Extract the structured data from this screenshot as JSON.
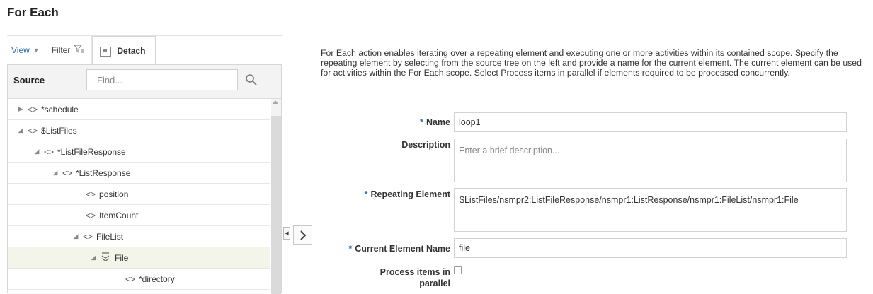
{
  "page": {
    "title": "For Each"
  },
  "toolbar": {
    "view_label": "View",
    "filter_label": "Filter",
    "detach_label": "Detach"
  },
  "source": {
    "label": "Source",
    "find_placeholder": "Find...",
    "tree": [
      {
        "label": "*schedule",
        "toggle": "collapsed",
        "icon": "element-icon"
      },
      {
        "label": "$ListFiles",
        "toggle": "expanded",
        "icon": "element-icon"
      },
      {
        "label": "*ListFileResponse",
        "toggle": "expanded",
        "icon": "element-icon"
      },
      {
        "label": "*ListResponse",
        "toggle": "expanded",
        "icon": "element-icon"
      },
      {
        "label": "position",
        "toggle": "none",
        "icon": "element-icon"
      },
      {
        "label": "ItemCount",
        "toggle": "none",
        "icon": "element-icon"
      },
      {
        "label": "FileList",
        "toggle": "expanded",
        "icon": "element-icon"
      },
      {
        "label": "File",
        "toggle": "expanded",
        "icon": "repeating-element-icon",
        "selected": true
      },
      {
        "label": "*directory",
        "toggle": "none",
        "icon": "element-icon"
      }
    ]
  },
  "description_text": "For Each action enables iterating over a repeating element and executing one or more activities within its contained scope. Specify the repeating element by selecting from the source tree on the left and provide a name for the current element. The current element can be used for activities within the For Each scope. Select Process items in parallel if elements required to be processed concurrently.",
  "form": {
    "required_marker": "*",
    "name_label": "Name",
    "name_value": "loop1",
    "description_label": "Description",
    "description_placeholder": "Enter a brief description...",
    "repeating_label": "Repeating Element",
    "repeating_value": "$ListFiles/nsmpr2:ListFileResponse/nsmpr1:ListResponse/nsmpr1:FileList/nsmpr1:File",
    "current_label": "Current Element Name",
    "current_value": "file",
    "parallel_label_line1": "Process items in",
    "parallel_label_line2": "parallel",
    "parallel_checked": false
  },
  "colors": {
    "accent": "#2b6cb0",
    "selected_row": "#f4f5ea"
  }
}
